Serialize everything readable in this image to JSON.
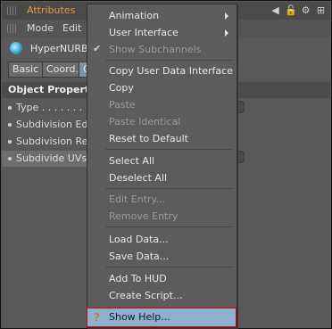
{
  "window": {
    "title": "Attributes"
  },
  "menubar": {
    "items": [
      "Mode",
      "Edit"
    ]
  },
  "object": {
    "name": "HyperNURBS"
  },
  "tabs": [
    "Basic",
    "Coord.",
    "O"
  ],
  "section_title": "Object Properties",
  "properties": [
    "Type . . . . . . . . .",
    "Subdivision Editor",
    "Subdivision Renderer",
    "Subdivide UVs"
  ],
  "context_menu": {
    "animation": "Animation",
    "user_interface": "User Interface",
    "show_subchannels": "Show Subchannels",
    "copy_user_data_interface": "Copy User Data Interface",
    "copy": "Copy",
    "paste": "Paste",
    "paste_identical": "Paste Identical",
    "reset_to_default": "Reset to Default",
    "select_all": "Select All",
    "deselect_all": "Deselect All",
    "edit_entry": "Edit Entry...",
    "remove_entry": "Remove Entry",
    "load_data": "Load Data...",
    "save_data": "Save Data...",
    "add_to_hud": "Add To HUD",
    "create_script": "Create Script...",
    "show_help": "Show Help..."
  },
  "colors": {
    "title_accent": "#e89a3b",
    "highlight": "#8fb0cf",
    "highlight_border": "#dd0000"
  }
}
